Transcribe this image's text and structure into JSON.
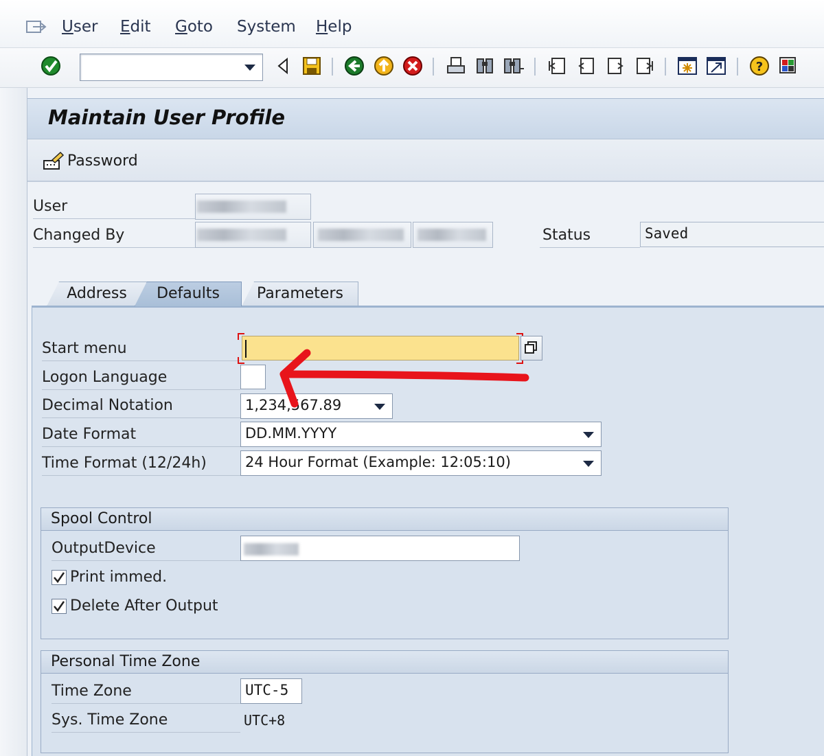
{
  "menubar": {
    "items": [
      {
        "hot": "U",
        "rest": "ser"
      },
      {
        "hot": "E",
        "rest": "dit"
      },
      {
        "hot": "G",
        "rest": "oto"
      },
      {
        "hot": "",
        "rest": "System"
      },
      {
        "hot": "H",
        "rest": "elp"
      }
    ]
  },
  "toolbar": {
    "command_field_value": "",
    "icons": [
      "enter-icon",
      "back-triangle-icon",
      "save-icon",
      "back-icon",
      "exit-icon",
      "cancel-icon",
      "print-icon",
      "find-icon",
      "find-next-icon",
      "first-page-icon",
      "previous-page-icon",
      "next-page-icon",
      "last-page-icon",
      "create-session-icon",
      "shortcut-icon",
      "help-icon",
      "customize-layout-icon"
    ]
  },
  "title": "Maintain User Profile",
  "app_toolbar": {
    "password_label": "Password"
  },
  "header": {
    "user_label": "User",
    "changed_by_label": "Changed By",
    "status_label": "Status",
    "status_value": "Saved"
  },
  "tabs": [
    {
      "label": "Address",
      "active": false
    },
    {
      "label": "Defaults",
      "active": true
    },
    {
      "label": "Parameters",
      "active": false
    }
  ],
  "defaults": {
    "start_menu_label": "Start menu",
    "start_menu_value": "",
    "logon_language_label": "Logon Language",
    "logon_language_value": "",
    "decimal_notation_label": "Decimal Notation",
    "decimal_notation_value": "1,234,567.89",
    "date_format_label": "Date Format",
    "date_format_value": "DD.MM.YYYY",
    "time_format_label": "Time Format (12/24h)",
    "time_format_value": "24 Hour Format (Example: 12:05:10)"
  },
  "spool_control": {
    "title": "Spool Control",
    "output_device_label": "OutputDevice",
    "print_immed_label": "Print immed.",
    "print_immed_checked": true,
    "delete_after_output_label": "Delete After Output",
    "delete_after_output_checked": true
  },
  "time_zone": {
    "title": "Personal Time Zone",
    "time_zone_label": "Time Zone",
    "time_zone_value": "UTC-5",
    "sys_time_zone_label": "Sys. Time Zone",
    "sys_time_zone_value": "UTC+8"
  },
  "colors": {
    "required_field": "#fbe28e",
    "annotation_arrow": "#e8141b",
    "active_tab": "#a9bfd8"
  }
}
